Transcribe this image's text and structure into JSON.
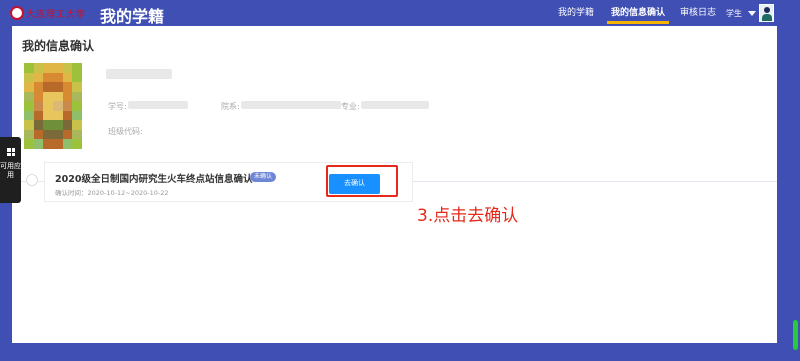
{
  "header": {
    "logo_text": "大连理工大学",
    "app_title": "我的学籍",
    "nav": [
      {
        "label": "我的学籍",
        "active": false
      },
      {
        "label": "我的信息确认",
        "active": true
      },
      {
        "label": "审核日志",
        "active": false
      }
    ],
    "role": "学生"
  },
  "page": {
    "title": "我的信息确认"
  },
  "profile": {
    "student_id_label": "学号:",
    "department_label": "院系:",
    "major_label": "专业:",
    "class_code_label": "班级代码:"
  },
  "task": {
    "title": "2020级全日制国内研究生火车终点站信息确认",
    "status_badge": "未确认",
    "period": "确认时间：2020-10-12~2020-10-22",
    "action_label": "去确认"
  },
  "annotation": {
    "text": "3.点击去确认"
  },
  "side_dock": {
    "label": "可用应用"
  },
  "colors": {
    "brand": "#3f4fb4",
    "accent_underline": "#f6b400",
    "primary_button": "#1890ff",
    "annotation_red": "#e5291a",
    "status_badge": "#6f86d6"
  },
  "icons": {
    "dock": "apps-grid-icon",
    "role_dropdown": "caret-down-icon"
  }
}
